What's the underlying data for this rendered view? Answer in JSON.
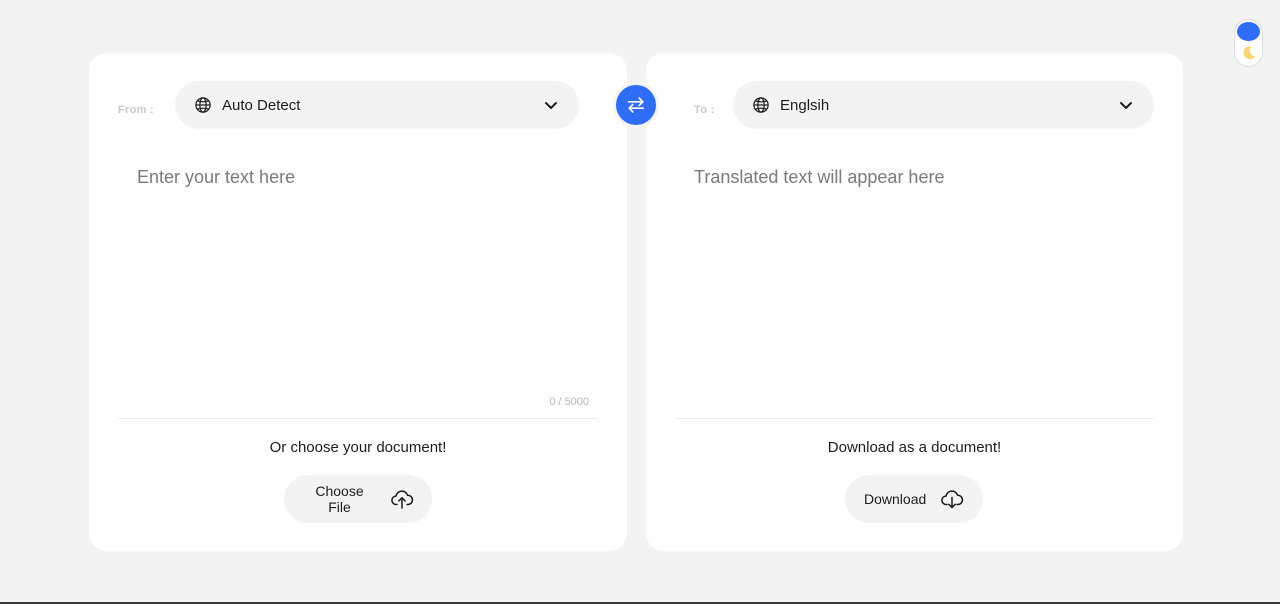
{
  "source": {
    "label": "From :",
    "language": "Auto Detect",
    "placeholder": "Enter your text here",
    "char_count": "0 / 5000",
    "doc_prompt": "Or choose your document!",
    "doc_button": "Choose File"
  },
  "target": {
    "label": "To :",
    "language": "Englsih",
    "placeholder": "Translated text will appear here",
    "doc_prompt": "Download as a document!",
    "doc_button": "Download"
  },
  "icons": {
    "language": "globe-icon",
    "dropdown": "chevron-down-icon",
    "upload": "cloud-upload-icon",
    "download": "cloud-download-icon",
    "swap": "swap-arrows-icon",
    "theme": "moon-icon"
  },
  "colors": {
    "accent": "#2f6df6",
    "background": "#f3f3f3",
    "card": "#ffffff",
    "moon": "#f5d76e"
  }
}
